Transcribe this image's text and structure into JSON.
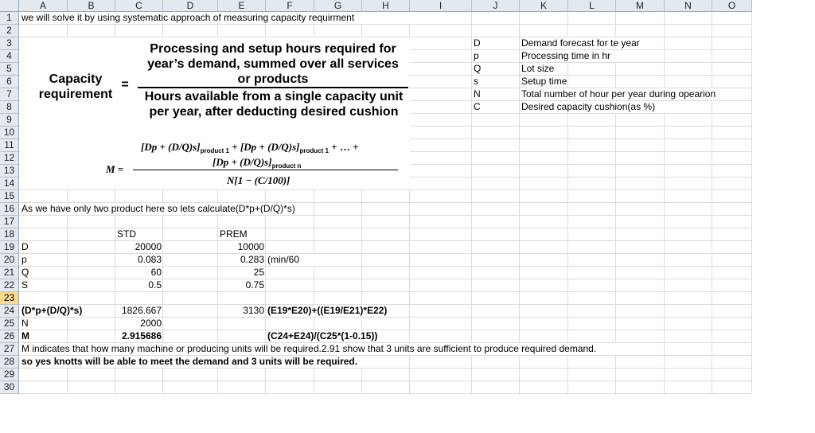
{
  "columns": [
    "A",
    "B",
    "C",
    "D",
    "E",
    "F",
    "G",
    "H",
    "I",
    "J",
    "K",
    "L",
    "M",
    "N",
    "O"
  ],
  "selected_row": 23,
  "row1": "we will solve it by using systematic approach of measuring capacity requirment",
  "formula": {
    "lhs": [
      "Capacity",
      "requirement"
    ],
    "equals": "=",
    "numerator": [
      "Processing and setup hours required for",
      "year’s demand, summed over all services",
      "or products"
    ],
    "denominator": [
      "Hours available from a single capacity unit",
      "per year, after deducting desired cushion"
    ],
    "m_lhs": "M =",
    "m_num1": "[Dp + (D/Q)s]",
    "m_sub1": "product 1",
    "m_plus": "+",
    "m_num2": "[Dp + (D/Q)s]",
    "m_sub2": "product 1",
    "m_ellipsis": "+ … +",
    "m_num3": "[Dp + (D/Q)s]",
    "m_sub3": "product n",
    "m_den": "N[1 − (C/100)]"
  },
  "legend": [
    {
      "sym": "D",
      "desc": "Demand forecast for te year"
    },
    {
      "sym": "p",
      "desc": "Processing time in hr"
    },
    {
      "sym": "Q",
      "desc": "Lot size"
    },
    {
      "sym": "s",
      "desc": "Setup time"
    },
    {
      "sym": "N",
      "desc": "Total number of hour per year during opearion"
    },
    {
      "sym": "C",
      "desc": "Desired capacity cushion(as %)"
    }
  ],
  "row16": "As we have only two product here so lets calculate(D*p+(D/Q)*s)",
  "table": {
    "std": "STD",
    "prem": "PREM",
    "rows": [
      {
        "label": "D",
        "std": "20000",
        "prem": "10000",
        "note": ""
      },
      {
        "label": "p",
        "std": "0.083",
        "prem": "0.283",
        "note": "(min/60"
      },
      {
        "label": "Q",
        "std": "60",
        "prem": "25",
        "note": ""
      },
      {
        "label": "S",
        "std": "0.5",
        "prem": "0.75",
        "note": ""
      }
    ]
  },
  "row24": {
    "label": "(D*p+(D/Q)*s)",
    "std": "1826.667",
    "prem": "3130",
    "note": "(E19*E20)+((E19/E21)*E22)"
  },
  "row25": {
    "label": "N",
    "std": "2000"
  },
  "row26": {
    "label": "M",
    "std": "2.915686",
    "note": "(C24+E24)/(C25*(1-0.15))"
  },
  "row27": "M  indicates that how many machine or producing units will be required.2.91 show that 3 units are sufficient to produce required demand.",
  "row28": "so yes knotts will be able to meet the demand and 3 units will be required."
}
